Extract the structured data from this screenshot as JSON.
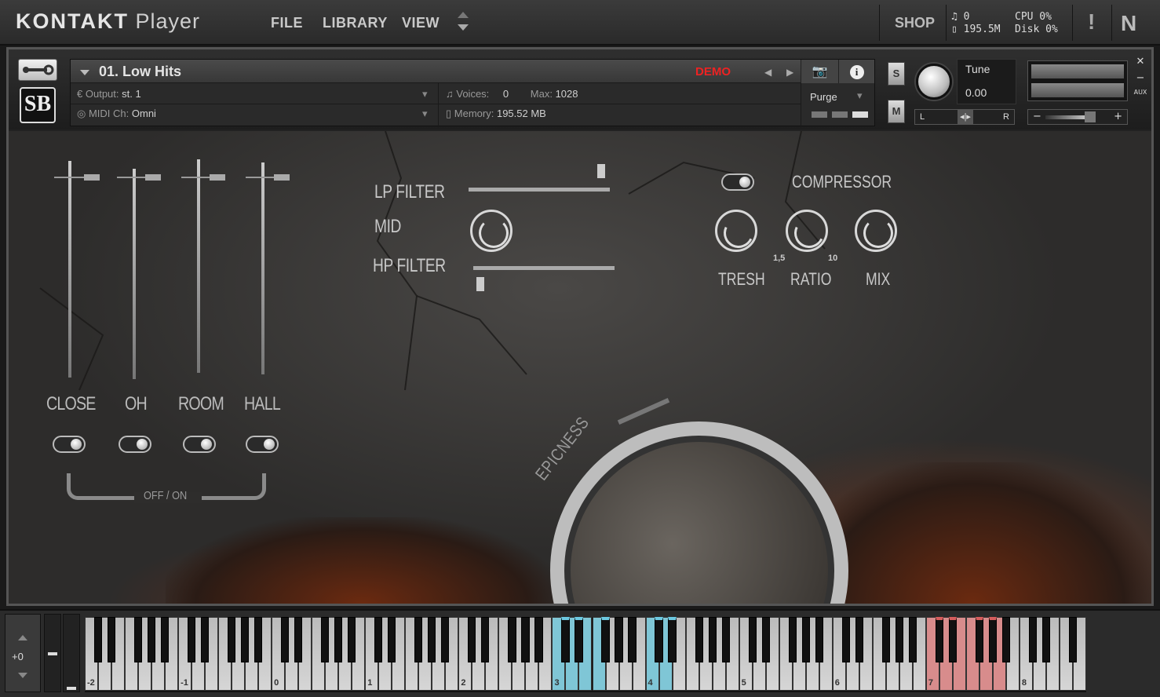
{
  "topbar": {
    "logo_main": "KONTAKT",
    "logo_sub": "Player",
    "menu": [
      "FILE",
      "LIBRARY",
      "VIEW"
    ],
    "shop": "SHOP",
    "midi_count": "0",
    "memory_total": "195.5M",
    "cpu": "CPU 0%",
    "disk": "Disk 0%",
    "warning": "!",
    "ni": "N"
  },
  "instrument": {
    "name": "01. Low Hits",
    "demo": "DEMO",
    "output_label": "Output:",
    "output_value": "st. 1",
    "midi_label": "MIDI Ch:",
    "midi_value": "Omni",
    "voices_label": "Voices:",
    "voices_value": "0",
    "max_label": "Max:",
    "max_value": "1028",
    "memory_label": "Memory:",
    "memory_value": "195.52 MB",
    "purge": "Purge",
    "solo": "S",
    "mute": "M",
    "tune_label": "Tune",
    "tune_value": "0.00",
    "pan_left": "L",
    "pan_right": "R",
    "vol_minus": "−",
    "vol_plus": "+",
    "logo": "SB",
    "aux": "AUX"
  },
  "mixer": {
    "channels": [
      "CLOSE",
      "OH",
      "ROOM",
      "HALL"
    ],
    "offon": "OFF / ON"
  },
  "filters": {
    "lp": "LP FILTER",
    "mid": "MID",
    "hp": "HP FILTER"
  },
  "compressor": {
    "title": "COMPRESSOR",
    "tresh": "TRESH",
    "ratio": "RATIO",
    "mix": "MIX",
    "ratio_min": "1,5",
    "ratio_max": "10"
  },
  "epicness": "EPICNESS",
  "keyboard": {
    "octave_shift": "+0",
    "octave_labels": [
      "-2",
      "-1",
      "0",
      "1",
      "2",
      "3",
      "4",
      "5",
      "6",
      "7",
      "8"
    ]
  },
  "colors": {
    "accent_red": "#e22222",
    "key_blue": "#7fc6d6",
    "key_red": "#d88c8c"
  }
}
